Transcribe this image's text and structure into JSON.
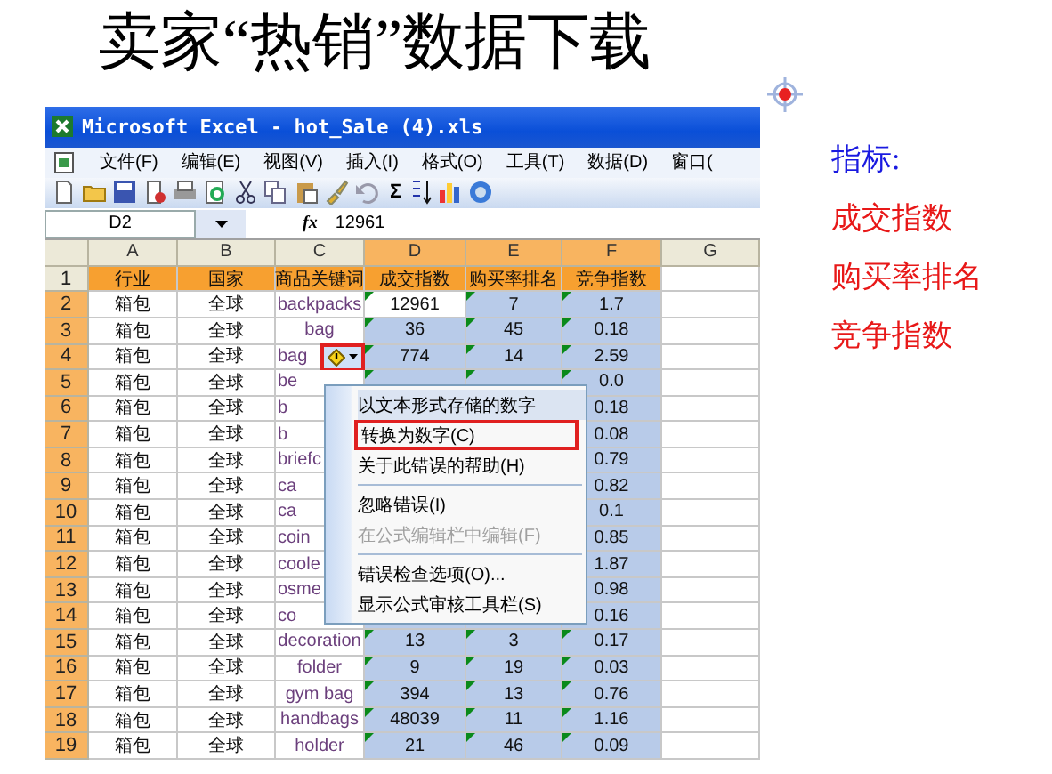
{
  "slide_title": "卖家“热销”数据下载",
  "window": {
    "title": "Microsoft Excel - hot_Sale (4).xls"
  },
  "menu": [
    "文件(F)",
    "编辑(E)",
    "视图(V)",
    "插入(I)",
    "格式(O)",
    "工具(T)",
    "数据(D)",
    "窗口("
  ],
  "toolbar": {
    "sum_label": "Σ"
  },
  "formula_bar": {
    "name_box": "D2",
    "fx_label": "fx",
    "value": "12961"
  },
  "sheet": {
    "text_number_flags": true,
    "columns": [
      {
        "label": "A",
        "selected": false
      },
      {
        "label": "B",
        "selected": false
      },
      {
        "label": "C",
        "selected": false
      },
      {
        "label": "D",
        "selected": true
      },
      {
        "label": "E",
        "selected": true
      },
      {
        "label": "F",
        "selected": true
      },
      {
        "label": "G",
        "selected": false
      }
    ],
    "rows": [
      {
        "number": "1",
        "selected": false,
        "header": true,
        "cells": [
          "行业",
          "国家",
          "商品关键词",
          "成交指数",
          "购买率排名",
          "竞争指数"
        ]
      },
      {
        "number": "2",
        "selected": true,
        "active": true,
        "cells": [
          "箱包",
          "全球",
          "backpacks",
          "12961",
          "7",
          "1.7"
        ]
      },
      {
        "number": "3",
        "selected": true,
        "cells": [
          "箱包",
          "全球",
          "bag",
          "36",
          "45",
          "0.18"
        ]
      },
      {
        "number": "4",
        "selected": true,
        "clipped": true,
        "smart_tag": true,
        "cells": [
          "箱包",
          "全球",
          "bag",
          "774",
          "14",
          "2.59"
        ]
      },
      {
        "number": "5",
        "selected": true,
        "clipped": true,
        "cells": [
          "箱包",
          "全球",
          "be",
          null,
          null,
          "0.0"
        ]
      },
      {
        "number": "6",
        "selected": true,
        "clipped": true,
        "cells": [
          "箱包",
          "全球",
          "b",
          null,
          null,
          "0.18"
        ]
      },
      {
        "number": "7",
        "selected": true,
        "clipped": true,
        "cells": [
          "箱包",
          "全球",
          "b",
          null,
          null,
          "0.08"
        ]
      },
      {
        "number": "8",
        "selected": true,
        "clipped": true,
        "cells": [
          "箱包",
          "全球",
          "briefc",
          null,
          null,
          "0.79"
        ]
      },
      {
        "number": "9",
        "selected": true,
        "clipped": true,
        "cells": [
          "箱包",
          "全球",
          "ca",
          null,
          null,
          "0.82"
        ]
      },
      {
        "number": "10",
        "selected": true,
        "clipped": true,
        "cells": [
          "箱包",
          "全球",
          "ca",
          null,
          null,
          "0.1"
        ]
      },
      {
        "number": "11",
        "selected": true,
        "clipped": true,
        "cells": [
          "箱包",
          "全球",
          "coin",
          null,
          null,
          "0.85"
        ]
      },
      {
        "number": "12",
        "selected": true,
        "clipped": true,
        "cells": [
          "箱包",
          "全球",
          "coole",
          null,
          null,
          "1.87"
        ]
      },
      {
        "number": "13",
        "selected": true,
        "clipped": true,
        "cells": [
          "箱包",
          "全球",
          "osme",
          null,
          null,
          "0.98"
        ]
      },
      {
        "number": "14",
        "selected": true,
        "clipped": true,
        "cells": [
          "箱包",
          "全球",
          "co",
          null,
          null,
          "0.16"
        ]
      },
      {
        "number": "15",
        "selected": true,
        "cells": [
          "箱包",
          "全球",
          "decoration",
          "13",
          "3",
          "0.17"
        ]
      },
      {
        "number": "16",
        "selected": true,
        "cells": [
          "箱包",
          "全球",
          "folder",
          "9",
          "19",
          "0.03"
        ]
      },
      {
        "number": "17",
        "selected": true,
        "cells": [
          "箱包",
          "全球",
          "gym bag",
          "394",
          "13",
          "0.76"
        ]
      },
      {
        "number": "18",
        "selected": true,
        "cells": [
          "箱包",
          "全球",
          "handbags",
          "48039",
          "11",
          "1.16"
        ]
      },
      {
        "number": "19",
        "selected": true,
        "cells": [
          "箱包",
          "全球",
          "holder",
          "21",
          "46",
          "0.09"
        ]
      }
    ]
  },
  "context_menu": [
    {
      "kind": "header",
      "label": "以文本形式存储的数字"
    },
    {
      "kind": "item",
      "label": "转换为数字(C)",
      "disabled": false,
      "marked": true
    },
    {
      "kind": "item",
      "label": "关于此错误的帮助(H)",
      "disabled": false,
      "marked": false
    },
    {
      "kind": "separator"
    },
    {
      "kind": "item",
      "label": "忽略错误(I)",
      "disabled": false,
      "marked": false
    },
    {
      "kind": "item",
      "label": "在公式编辑栏中编辑(F)",
      "disabled": true,
      "marked": false
    },
    {
      "kind": "separator"
    },
    {
      "kind": "item",
      "label": "错误检查选项(O)...",
      "disabled": false,
      "marked": false
    },
    {
      "kind": "item",
      "label": "显示公式审核工具栏(S)",
      "disabled": false,
      "marked": false
    }
  ],
  "notes": [
    {
      "kind": "heading",
      "text": "指标:"
    },
    {
      "kind": "point",
      "text": "成交指数"
    },
    {
      "kind": "point",
      "text": "购买率排名"
    },
    {
      "kind": "point",
      "text": "竞争指数"
    }
  ]
}
